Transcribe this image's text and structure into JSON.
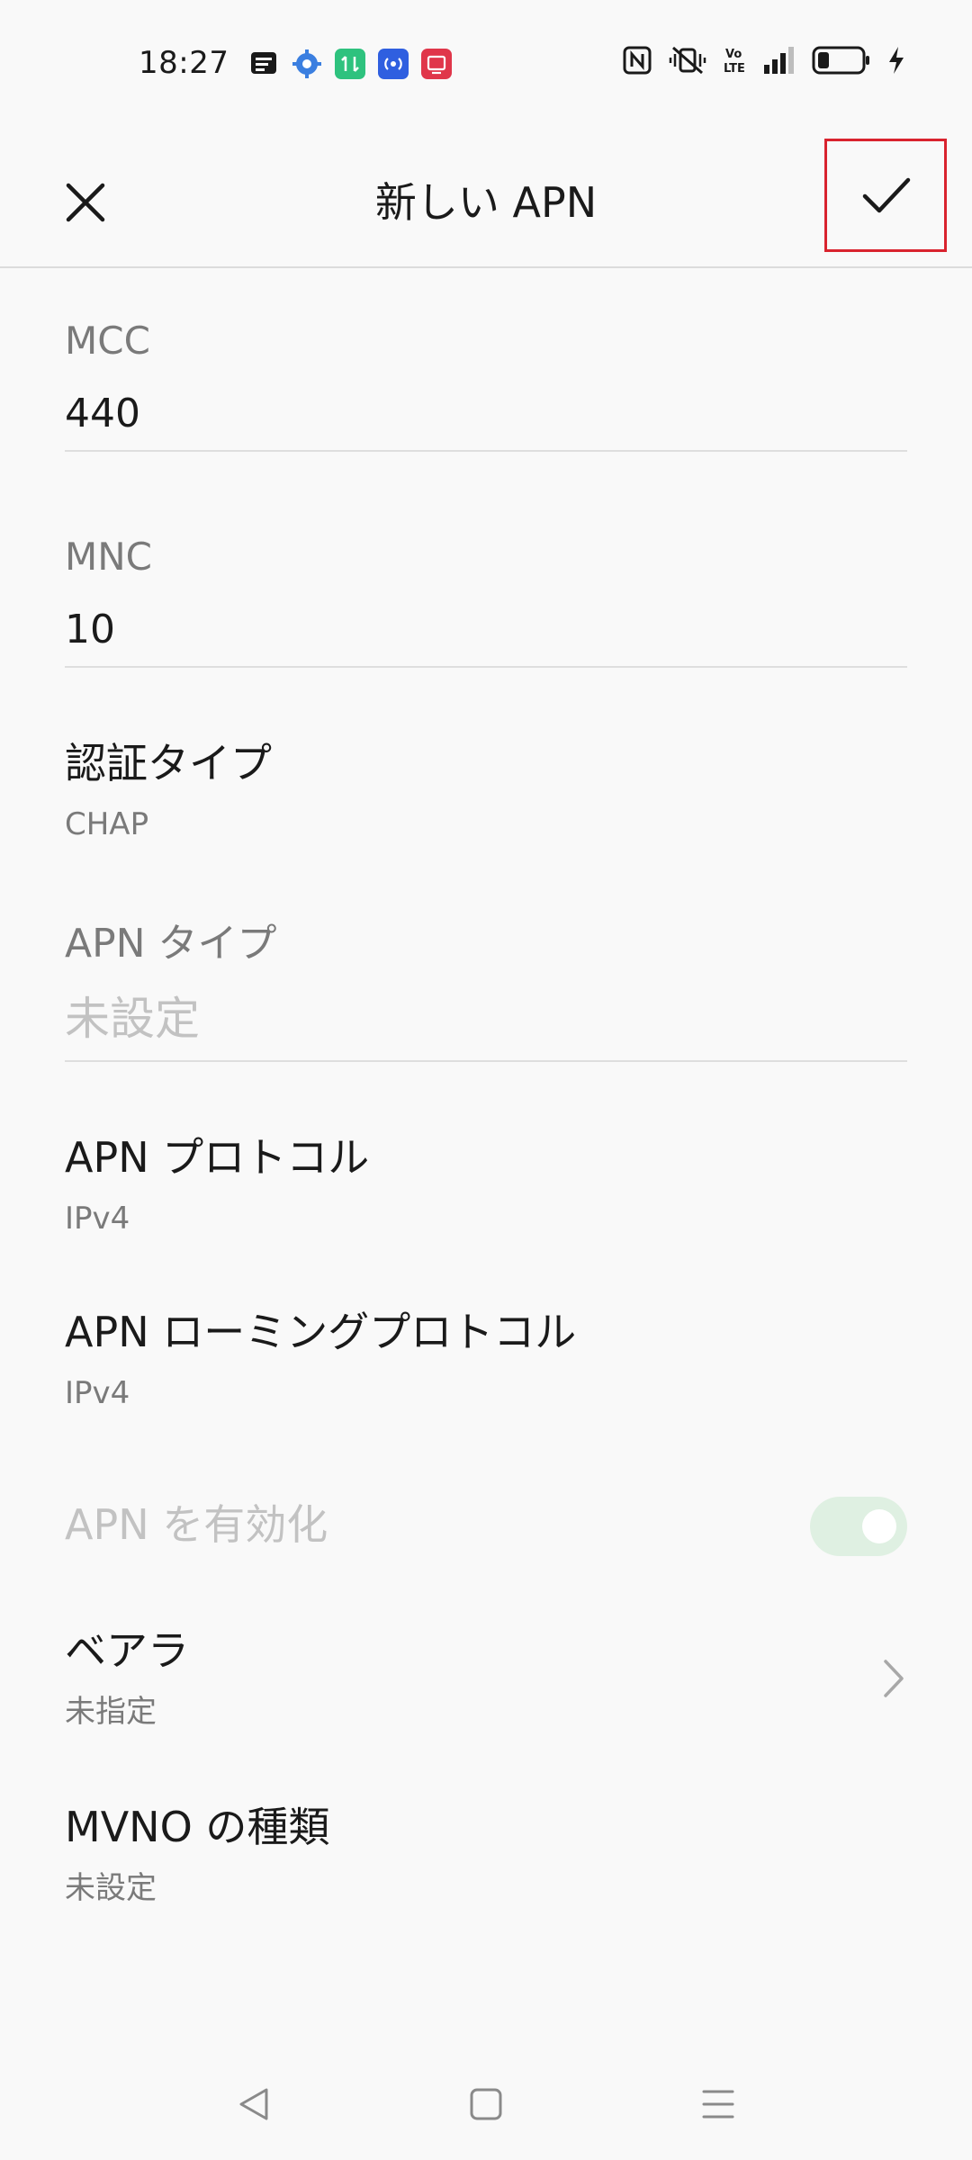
{
  "status_bar": {
    "time": "18:27",
    "notification_icons": [
      "message-icon",
      "settings-gear-icon",
      "data-transfer-icon",
      "hotspot-icon",
      "screen-record-icon"
    ],
    "system_icons": [
      "nfc-icon",
      "vibrate-mute-icon",
      "volte-icon",
      "signal-icon",
      "battery-icon",
      "charging-bolt-icon"
    ],
    "volte_text": "Vo LTE"
  },
  "app_bar": {
    "title": "新しい APN",
    "close_icon": "close-icon",
    "confirm_icon": "checkmark-icon",
    "highlight_color": "#d9232e"
  },
  "fields": {
    "mcc": {
      "label": "MCC",
      "value": "440"
    },
    "mnc": {
      "label": "MNC",
      "value": "10"
    },
    "auth_type": {
      "title": "認証タイプ",
      "summary": "CHAP"
    },
    "apn_type": {
      "label": "APN タイプ",
      "placeholder": "未設定"
    },
    "apn_protocol": {
      "title": "APN プロトコル",
      "summary": "IPv4"
    },
    "apn_roaming_protocol": {
      "title": "APN ローミングプロトコル",
      "summary": "IPv4"
    },
    "apn_enable": {
      "title": "APN を有効化",
      "toggle_on": true,
      "toggle_color": "#dff0e2"
    },
    "bearer": {
      "title": "ベアラ",
      "summary": "未指定"
    },
    "mvno_type": {
      "title": "MVNO の種類",
      "summary": "未設定"
    }
  },
  "nav_bar": {
    "icons": [
      "back-triangle-icon",
      "home-square-icon",
      "recents-menu-icon"
    ]
  }
}
